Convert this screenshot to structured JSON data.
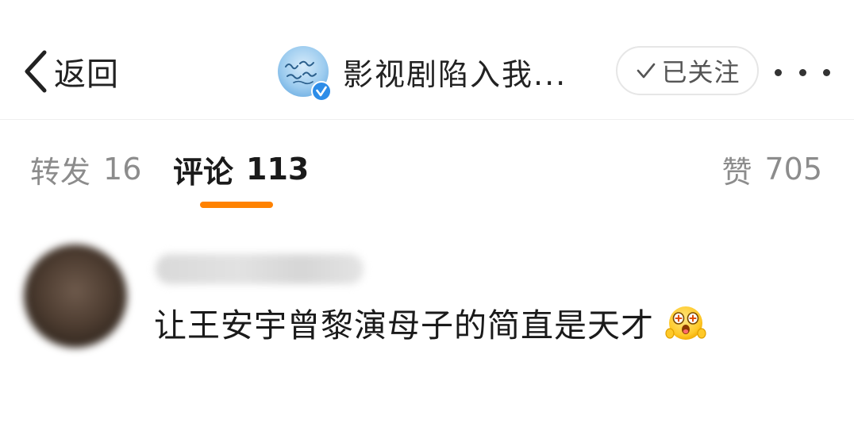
{
  "header": {
    "back_label": "返回",
    "account_name": "影视剧陷入我...",
    "avatar_icon": "account-avatar",
    "verified_icon": "verified-badge-icon",
    "follow_label": "已关注",
    "follow_icon": "check-icon",
    "more_icon": "more-dots-icon"
  },
  "tabs": {
    "repost_label": "转发",
    "repost_count": "16",
    "comment_label": "评论",
    "comment_count": "113",
    "like_label": "赞",
    "like_count": "705",
    "active_tab": "comment"
  },
  "comment": {
    "text": "让王安宇曾黎演母子的简直是天才",
    "emoji": "excited-face-emoji"
  },
  "colors": {
    "accent": "#ff8200",
    "verified": "#2d8de8",
    "text_primary": "#1a1a1a",
    "text_secondary": "#8c8c8c"
  }
}
